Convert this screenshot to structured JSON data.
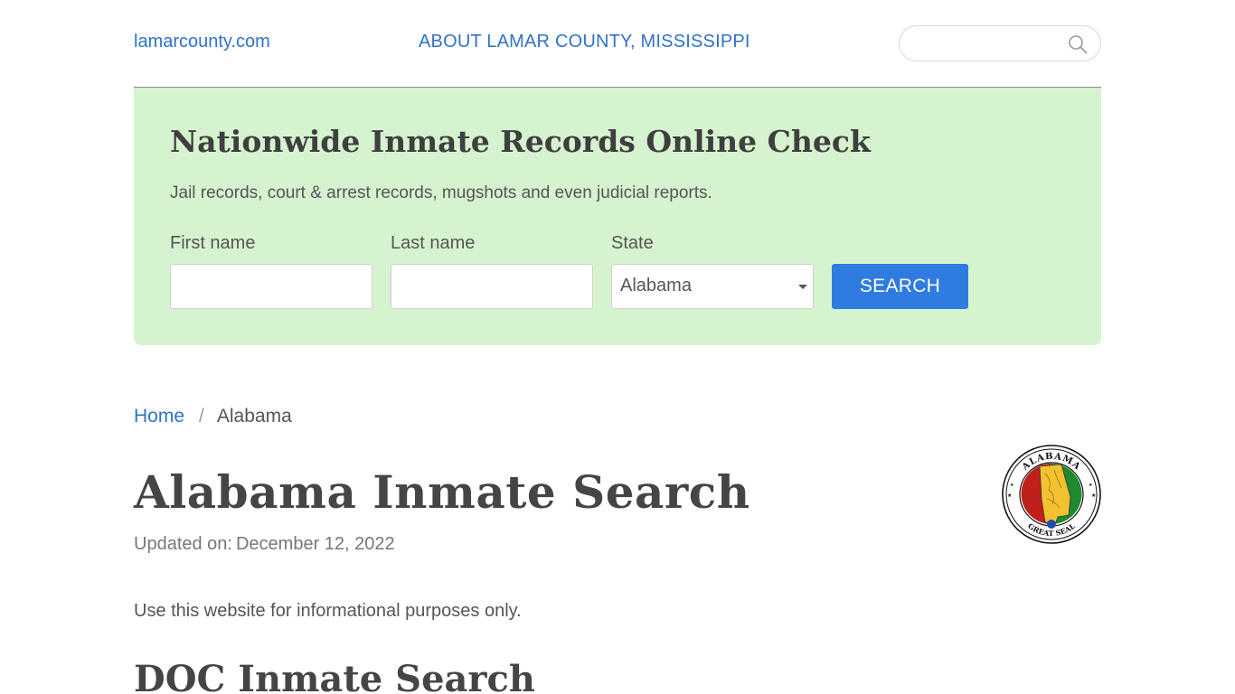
{
  "header": {
    "site_name": "lamarcounty.com",
    "about_label": "ABOUT LAMAR COUNTY, MISSISSIPPI",
    "search_placeholder": ""
  },
  "panel": {
    "title": "Nationwide Inmate Records Online Check",
    "subtitle": "Jail records, court & arrest records, mugshots and even judicial reports.",
    "first_name_label": "First name",
    "last_name_label": "Last name",
    "state_label": "State",
    "state_value": "Alabama",
    "search_button": "SEARCH",
    "bg_color": "#d6f3cf",
    "button_color": "#2f7be0"
  },
  "breadcrumb": {
    "home": "Home",
    "separator": "/",
    "current": "Alabama"
  },
  "main": {
    "title": "Alabama Inmate Search",
    "updated_label": "Updated on:",
    "updated_date": "December 12, 2022",
    "info": "Use this website for informational purposes only.",
    "section_title": "DOC Inmate Search"
  },
  "seal": {
    "top_text": "ALABAMA",
    "bottom_text": "GREAT SEAL",
    "colors": [
      "#c0201b",
      "#f2c230",
      "#1f8a2e"
    ]
  },
  "colors": {
    "link": "#2f72c9",
    "text": "#4a4a4a"
  }
}
